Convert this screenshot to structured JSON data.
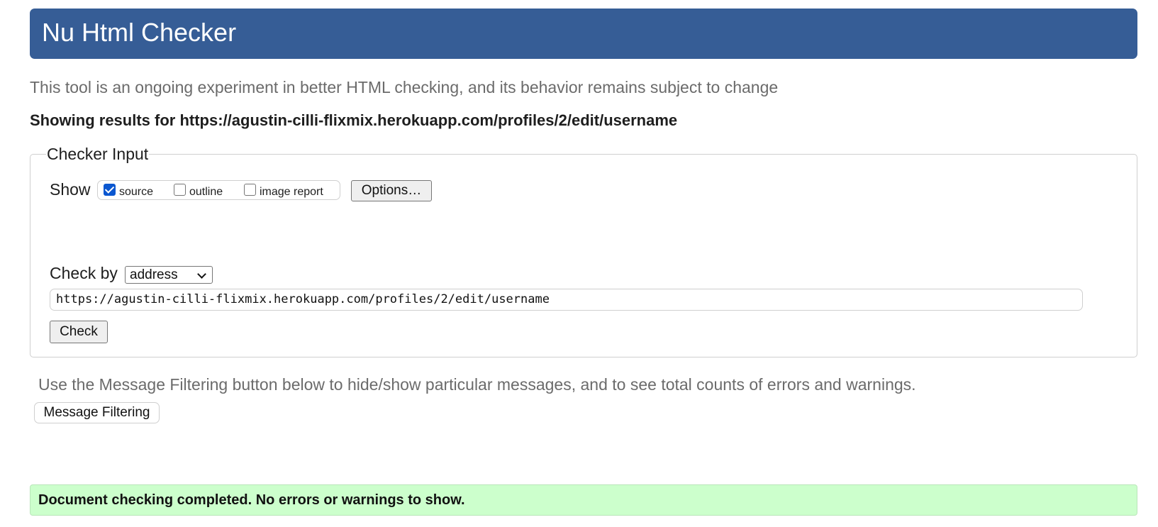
{
  "header": {
    "title": "Nu Html Checker"
  },
  "intro": {
    "text": "This tool is an ongoing experiment in better HTML checking, and its behavior remains subject to change"
  },
  "results": {
    "label": "Showing results for https://agustin-cilli-flixmix.herokuapp.com/profiles/2/edit/username"
  },
  "checker_input": {
    "legend": "Checker Input",
    "show_label": "Show",
    "show_options": [
      {
        "label": "source",
        "checked": true
      },
      {
        "label": "outline",
        "checked": false
      },
      {
        "label": "image report",
        "checked": false
      }
    ],
    "options_button": "Options…",
    "check_by_label": "Check by",
    "check_by_value": "address",
    "url_value": "https://agustin-cilli-flixmix.herokuapp.com/profiles/2/edit/username",
    "check_button": "Check"
  },
  "filtering": {
    "text": "Use the Message Filtering button below to hide/show particular messages, and to see total counts of errors and warnings.",
    "button": "Message Filtering"
  },
  "status": {
    "message": "Document checking completed. No errors or warnings to show."
  },
  "colors": {
    "header_bg": "#365d96",
    "success_bg": "#ccffcc",
    "checkbox_accent": "#0b57d0"
  },
  "icons": {
    "select_chevron": "chevron-down-icon",
    "checkbox_check": "checkmark-icon"
  }
}
